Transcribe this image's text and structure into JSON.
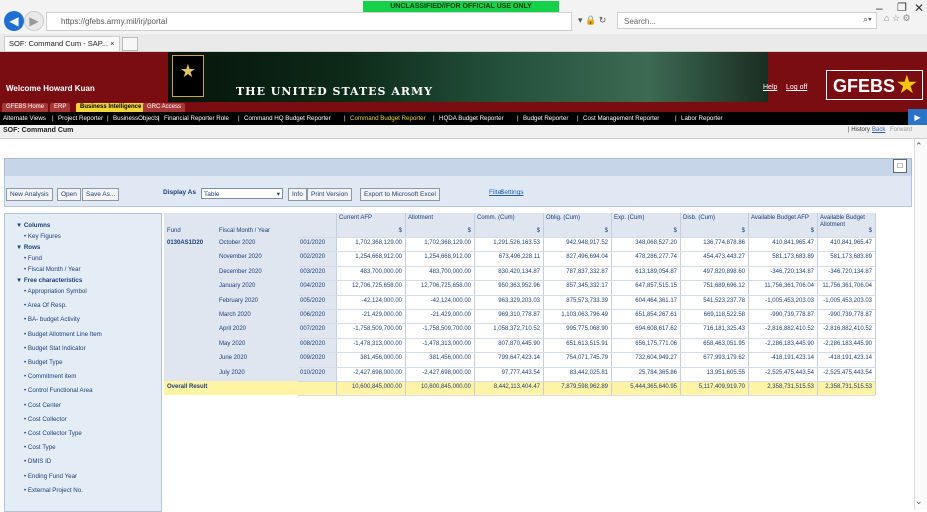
{
  "browser": {
    "classification_banner": "UNCLASSIFIED//FOR OFFICIAL USE ONLY",
    "url": "https://gfebs.army.mil/irj/portal",
    "search_placeholder": "Search...",
    "tab_title": "SOF: Command Cum - SAP...",
    "tab_close": "×"
  },
  "header": {
    "welcome": "Welcome Howard Kuan",
    "army_title": "THE UNITED STATES ARMY",
    "help": "Help",
    "logoff": "Log off",
    "logo": "GFEBS",
    "logo_star": "★",
    "seal_glyph": "★"
  },
  "nav_tabs_top": [
    "GFEBS Home",
    "ERP",
    "Business Intelligence",
    "GRC Access"
  ],
  "nav_tabs_second": [
    "Alternate Views",
    "|",
    "Project Reporter",
    "|",
    "BusinessObjects",
    "|",
    "Financial Reporter Role",
    "|",
    "Command HQ Budget Reporter",
    "|",
    "Command Budget Reporter",
    "|",
    "HQDA Budget Reporter",
    "|",
    "Budget Reporter",
    "|",
    "Cost Management Reporter",
    "|",
    "Labor Reporter"
  ],
  "page": {
    "title": "SOF: Command Cum",
    "history": "| History",
    "back": "Back",
    "forward": "Forward"
  },
  "toolbar": {
    "new_analysis": "New Analysis",
    "open": "Open",
    "save_as": "Save As...",
    "display_as_label": "Display As",
    "display_as_value": "Table",
    "info": "Info",
    "print_version": "Print Version",
    "export": "Export to Microsoft Excel",
    "filter": "Filter",
    "settings": "Settings"
  },
  "nav_panel": {
    "columns": "▼ Columns",
    "key_figures": "• Key Figures",
    "rows": "▼ Rows",
    "fund": "• Fund",
    "fiscal_month": "• Fiscal Month / Year",
    "free_characteristics": "▼ Free characteristics",
    "items": [
      "• Appropriation Symbol",
      "• Area Of Resp.",
      "• BA- budget Activity",
      "• Budget Allotment Line Item",
      "• Budget Stat Indicator",
      "• Budget Type",
      "• Commitment item",
      "• Control Functional Area",
      "• Cost Center",
      "• Cost Collector",
      "• Cost Collector Type",
      "• Cost Type",
      "• DMIS ID",
      "• Ending Fund Year",
      "• External Project No."
    ]
  },
  "table": {
    "col_headers": [
      "Current AFP",
      "Allotment",
      "Comm. (Cum)",
      "Oblig. (Cum)",
      "Exp. (Cum)",
      "Disb. (Cum)",
      "Available Budget AFP",
      "Available Budget Allotment"
    ],
    "unit": "$",
    "row_header_fund": "Fund",
    "row_header_month": "Fiscal Month / Year",
    "fund": "0130AS1D20",
    "rows": [
      {
        "month": "October 2020",
        "period": "001/2020",
        "values": [
          "1,702,368,129.00",
          "1,702,368,129.00",
          "1,291,526,163.53",
          "942,948,917.52",
          "348,068,527.20",
          "136,774,878.86",
          "410,841,965.47",
          "410,841,965.47"
        ]
      },
      {
        "month": "November 2020",
        "period": "002/2020",
        "values": [
          "1,254,668,912.00",
          "1,254,668,912.00",
          "673,496,228.11",
          "827,496,694.04",
          "478,286,277.74",
          "454,473,443.27",
          "581,173,683.89",
          "581,173,683.89"
        ]
      },
      {
        "month": "December 2020",
        "period": "003/2020",
        "values": [
          "483,700,000.00",
          "483,700,000.00",
          "830,420,134.87",
          "787,837,332.87",
          "613,189,054.87",
          "497,820,898.60",
          "-346,720,134.87",
          "-346,720,134.87"
        ]
      },
      {
        "month": "January 2020",
        "period": "004/2020",
        "values": [
          "12,706,725,658.00",
          "12,706,725,658.00",
          "950,363,952.96",
          "857,345,332.17",
          "647,857,515.15",
          "751,689,696.12",
          "11,756,361,706.04",
          "11,756,361,706.04"
        ]
      },
      {
        "month": "February 2020",
        "period": "005/2020",
        "values": [
          "-42,124,000.00",
          "-42,124,000.00",
          "963,329,203.03",
          "875,573,733.39",
          "604,464,361.17",
          "541,523,237.78",
          "-1,005,453,203.03",
          "-1,005,453,203.03"
        ]
      },
      {
        "month": "March 2020",
        "period": "006/2020",
        "values": [
          "-21,429,000.00",
          "-21,429,000.00",
          "969,310,778.87",
          "1,103,063,796.49",
          "651,854,267.61",
          "669,118,522.58",
          "-990,739,778.87",
          "-990,739,778.87"
        ]
      },
      {
        "month": "April 2020",
        "period": "007/2020",
        "values": [
          "-1,758,509,700.00",
          "-1,758,509,700.00",
          "1,058,372,710.52",
          "995,775,068.90",
          "694,608,617.62",
          "716,181,325.43",
          "-2,816,882,410.52",
          "-2,816,882,410.52"
        ]
      },
      {
        "month": "May 2020",
        "period": "008/2020",
        "values": [
          "-1,478,313,000.00",
          "-1,478,313,000.00",
          "807,870,445.90",
          "651,613,515.91",
          "656,175,771.06",
          "658,463,051.95",
          "-2,286,183,445.90",
          "-2,286,183,445.90"
        ]
      },
      {
        "month": "June 2020",
        "period": "009/2020",
        "values": [
          "381,456,000.00",
          "381,456,000.00",
          "799,647,423.14",
          "754,071,745.79",
          "732,604,949.27",
          "677,993,179.62",
          "-418,191,423.14",
          "-418,191,423.14"
        ]
      },
      {
        "month": "July 2020",
        "period": "010/2020",
        "values": [
          "-2,427,698,000.00",
          "-2,427,698,000.00",
          "97,777,443.54",
          "83,442,025.81",
          "25,784,365.86",
          "13,951,605.55",
          "-2,525,475,443.54",
          "-2,525,475,443.54"
        ]
      }
    ],
    "overall_label": "Overall Result",
    "overall_values": [
      "10,600,845,000.00",
      "10,600,845,000.00",
      "8,442,113,404.47",
      "7,879,598,962.89",
      "5,444,365,640.95",
      "5,117,409,919.70",
      "2,358,731,515.53",
      "2,358,731,515.53"
    ]
  },
  "colors": {
    "header_red": "#7a0d12",
    "classification_green": "#15d14a",
    "total_row_yellow": "#fff3a6",
    "link_blue": "#1d5fb8",
    "active_tab_yellow": "#f0d43a"
  }
}
